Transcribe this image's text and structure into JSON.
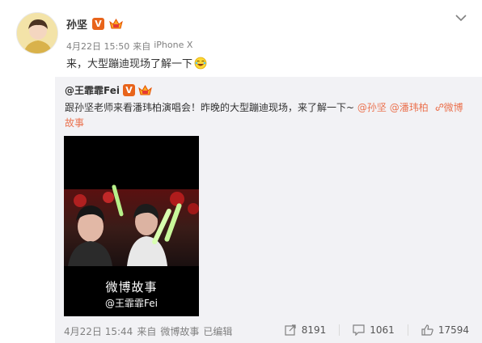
{
  "post": {
    "author": "孙坚",
    "date": "4月22日 15:50",
    "source_prefix": "来自",
    "source": "iPhone X",
    "text": "来，大型蹦迪现场了解一下",
    "emoji_icon": "laugh-emoji-icon"
  },
  "repost": {
    "author": "@王霏霏Fei",
    "text_main": "跟孙坚老师来看潘玮柏演唱会！昨晚的大型蹦迪现场，来了解一下~",
    "mention1": "@孙坚",
    "mention2": "@潘玮柏",
    "story_link_a": "微博",
    "story_link_b": "故事",
    "video": {
      "caption": "微博故事",
      "watermark": "@王霏霏Fei"
    },
    "date": "4月22日 15:44",
    "source_prefix": "来自",
    "source": "微博故事",
    "edited": "已编辑",
    "reposts": "8191",
    "comments": "1061",
    "likes": "17594"
  },
  "colors": {
    "link": "#eb7350",
    "repost_bg": "#f2f2f5",
    "badge": "#e8641b"
  }
}
